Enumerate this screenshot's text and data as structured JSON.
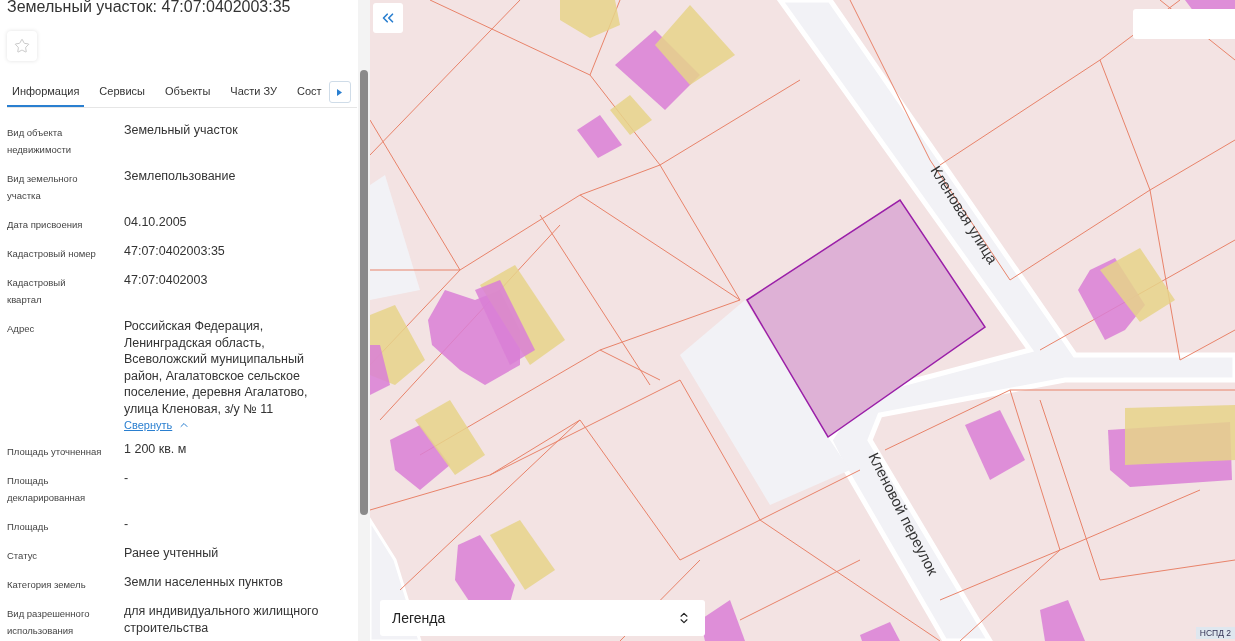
{
  "panel": {
    "title": "Земельный участок: 47:07:0402003:35",
    "favorite": false,
    "tabs": [
      {
        "label": "Информация",
        "selected": true
      },
      {
        "label": "Сервисы",
        "selected": false
      },
      {
        "label": "Объекты",
        "selected": false
      },
      {
        "label": "Части ЗУ",
        "selected": false
      },
      {
        "label": "Сост",
        "selected": false
      }
    ],
    "rows": [
      {
        "label": "Вид объекта недвижимости",
        "value": "Земельный участок"
      },
      {
        "label": "Вид земельного участка",
        "value": "Землепользование"
      },
      {
        "label": "Дата присвоения",
        "value": "04.10.2005"
      },
      {
        "label": "Кадастровый номер",
        "value": "47:07:0402003:35"
      },
      {
        "label": "Кадастровый квартал",
        "value": "47:07:0402003"
      },
      {
        "label": "Адрес",
        "value": "Российская Федерация, Ленинградская область, Всеволожский муниципальный район, Агалатовское сельское поселение, деревня Агалатово, улица Кленовая, з/у № 11",
        "toggle": {
          "label": "Свернуть",
          "expanded": true
        }
      },
      {
        "label": "Площадь уточненная",
        "value": "1 200 кв. м"
      },
      {
        "label": "Площадь декларированная",
        "value": "-"
      },
      {
        "label": "Площадь",
        "value": "-"
      },
      {
        "label": "Статус",
        "value": "Ранее учтенный"
      },
      {
        "label": "Категория земель",
        "value": "Земли населенных пунктов"
      },
      {
        "label": "Вид разрешенного использования",
        "value": "для индивидуального жилищного строительства"
      }
    ]
  },
  "map": {
    "streets": [
      {
        "name": "Кленовая улица"
      },
      {
        "name": "Кленовой переулок"
      }
    ],
    "legend": {
      "label": "Легенда"
    },
    "attribution": "НСПД 2"
  }
}
